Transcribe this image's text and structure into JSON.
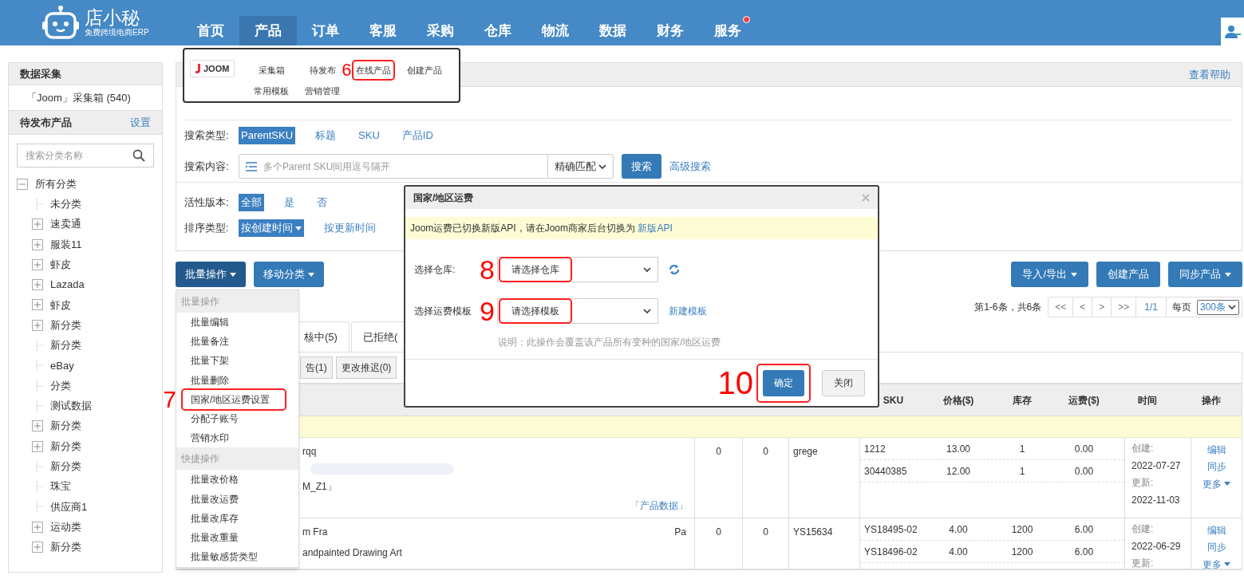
{
  "header": {
    "brand": "店小秘",
    "tagline": "免费跨境电商ERP",
    "nav": [
      {
        "label": "首页",
        "selected": false,
        "badge": false
      },
      {
        "label": "产品",
        "selected": true,
        "badge": false
      },
      {
        "label": "订单",
        "selected": false,
        "badge": false
      },
      {
        "label": "客服",
        "selected": false,
        "badge": false
      },
      {
        "label": "采购",
        "selected": false,
        "badge": false
      },
      {
        "label": "仓库",
        "selected": false,
        "badge": false
      },
      {
        "label": "物流",
        "selected": false,
        "badge": false
      },
      {
        "label": "数据",
        "selected": false,
        "badge": false
      },
      {
        "label": "财务",
        "selected": false,
        "badge": false
      },
      {
        "label": "服务",
        "selected": false,
        "badge": true
      }
    ]
  },
  "sidebar": {
    "collect_title": "数据采集",
    "collect_items": [
      "「Joom」采集箱 (540)"
    ],
    "pending_title": "待发布产品",
    "pending_action": "设置",
    "search_placeholder": "搜索分类名称",
    "tree": [
      {
        "label": "所有分类",
        "kind": "expanded",
        "children": [
          {
            "label": "未分类",
            "kind": "leaf"
          },
          {
            "label": "速卖通",
            "kind": "collapsed"
          },
          {
            "label": "服装11",
            "kind": "collapsed"
          },
          {
            "label": "虾皮",
            "kind": "collapsed"
          },
          {
            "label": "Lazada",
            "kind": "collapsed"
          },
          {
            "label": "虾皮",
            "kind": "collapsed"
          },
          {
            "label": "新分类",
            "kind": "collapsed"
          },
          {
            "label": "新分类",
            "kind": "leaf"
          },
          {
            "label": "eBay",
            "kind": "leaf"
          },
          {
            "label": "分类",
            "kind": "leaf"
          },
          {
            "label": "测试数据",
            "kind": "leaf"
          },
          {
            "label": "新分类",
            "kind": "collapsed"
          },
          {
            "label": "新分类",
            "kind": "collapsed"
          },
          {
            "label": "新分类",
            "kind": "leaf"
          },
          {
            "label": "珠宝",
            "kind": "leaf"
          },
          {
            "label": "供应商1",
            "kind": "leaf"
          },
          {
            "label": "运动类",
            "kind": "collapsed"
          },
          {
            "label": "新分类",
            "kind": "collapsed"
          }
        ]
      }
    ]
  },
  "panel": {
    "help": "查看帮助",
    "search_type": {
      "label": "搜索类型:",
      "options": [
        {
          "label": "ParentSKU",
          "selected": true
        },
        {
          "label": "标题",
          "selected": false
        },
        {
          "label": "SKU",
          "selected": false
        },
        {
          "label": "产品ID",
          "selected": false
        }
      ]
    },
    "search_content": {
      "label": "搜索内容:",
      "placeholder": "多个Parent SKU间用逗号隔开",
      "match": "精确匹配",
      "button": "搜索",
      "advanced": "高级搜索"
    },
    "active_version": {
      "label": "活性版本:",
      "options": [
        {
          "label": "全部",
          "selected": true
        },
        {
          "label": "是",
          "selected": false
        },
        {
          "label": "否",
          "selected": false
        }
      ]
    },
    "sort_type": {
      "label": "排序类型:",
      "options": [
        {
          "label": "按创建时间",
          "selected": true,
          "menu": true
        },
        {
          "label": "按更新时间",
          "selected": false,
          "menu": false
        }
      ]
    }
  },
  "toolbar": {
    "left": [
      {
        "label": "批量操作",
        "active": true,
        "menu": true
      },
      {
        "label": "移动分类",
        "active": false,
        "menu": true
      }
    ],
    "right": [
      {
        "label": "导入/导出",
        "menu": true
      },
      {
        "label": "创建产品",
        "menu": false
      },
      {
        "label": "同步产品",
        "menu": true
      }
    ]
  },
  "pagination": {
    "summary": "第1-6条，共6条",
    "buttons": [
      "<<",
      "<",
      ">",
      ">>"
    ],
    "page": "1/1",
    "per_page_label": "每页",
    "per_page": "300条"
  },
  "tabs": [
    {
      "label": "核中(5)",
      "selected": false
    },
    {
      "label": "已拒绝(",
      "selected": false
    }
  ],
  "filters": [
    "告(1)",
    "更改推迟(0)"
  ],
  "table": {
    "columns": [
      "SKU",
      "价格($)",
      "库存",
      "运费($)",
      "时间",
      "操作"
    ],
    "rows": [
      {
        "product_lines": [
          "rqq",
          "M_Z1」"
        ],
        "product_link": "「产品数据」",
        "column_2": "0",
        "column_3": "0",
        "column_4": "grege",
        "variants": [
          {
            "sku": "1212",
            "price": "13.00",
            "stock": "1",
            "shipping": "0.00"
          },
          {
            "sku": "30440385",
            "price": "12.00",
            "stock": "1",
            "shipping": "0.00"
          }
        ],
        "time": [
          "创建:",
          "2022-07-27",
          "更新:",
          "2022-11-03"
        ],
        "actions": [
          {
            "label": "编辑",
            "menu": false
          },
          {
            "label": "同步",
            "menu": false
          },
          {
            "label": "更多",
            "menu": true
          }
        ]
      },
      {
        "product_lines": [
          "m Fra",
          "andpainted Drawing Art"
        ],
        "product_tail": "Pa",
        "column_2": "0",
        "column_3": "0",
        "column_4": "YS15634",
        "variants": [
          {
            "sku": "YS18495-02",
            "price": "4.00",
            "stock": "1200",
            "shipping": "6.00"
          },
          {
            "sku": "YS18496-02",
            "price": "4.00",
            "stock": "1200",
            "shipping": "6.00"
          }
        ],
        "time": [
          "创建:",
          "2022-06-29",
          "更新:"
        ],
        "actions": [
          {
            "label": "编辑",
            "menu": false
          },
          {
            "label": "同步",
            "menu": false
          },
          {
            "label": "更多",
            "menu": true
          }
        ]
      }
    ]
  },
  "menu_popup": {
    "logo": "JOOM",
    "items": [
      {
        "label": "采集箱",
        "highlighted": false
      },
      {
        "label": "待发布",
        "highlighted": false
      },
      {
        "label": "在线产品",
        "highlighted": true,
        "callout": "6"
      },
      {
        "label": "创建产品",
        "highlighted": false
      },
      {
        "label": "常用模板",
        "highlighted": false
      },
      {
        "label": "营销管理",
        "highlighted": false
      }
    ]
  },
  "bulk_menu": {
    "groups": [
      {
        "title": "批量操作",
        "items": [
          {
            "label": "批量编辑",
            "highlighted": false
          },
          {
            "label": "批量备注",
            "highlighted": false
          },
          {
            "label": "批量下架",
            "highlighted": false
          },
          {
            "label": "批量删除",
            "highlighted": false
          },
          {
            "label": "国家/地区运费设置",
            "highlighted": true,
            "callout": "7"
          },
          {
            "label": "分配子账号",
            "highlighted": false
          },
          {
            "label": "营销水印",
            "highlighted": false
          }
        ]
      },
      {
        "title": "快捷操作",
        "items": [
          {
            "label": "批量改价格",
            "highlighted": false
          },
          {
            "label": "批量改运费",
            "highlighted": false
          },
          {
            "label": "批量改库存",
            "highlighted": false
          },
          {
            "label": "批量改重量",
            "highlighted": false
          },
          {
            "label": "批量敏感货类型",
            "highlighted": false
          }
        ]
      }
    ]
  },
  "dialog": {
    "title": "国家/地区运费",
    "notice": "Joom运费已切换新版API，请在Joom商家后台切换为",
    "notice_link": "新版API",
    "fields": [
      {
        "label": "选择仓库:",
        "value": "请选择仓库",
        "highlighted": true,
        "callout": "8",
        "kind": "refresh"
      },
      {
        "label": "选择运费模板",
        "value": "请选择模板",
        "highlighted": true,
        "callout": "9",
        "kind": "link",
        "link": "新建模板"
      }
    ],
    "note": "说明：此操作会覆盖该产品所有变种的国家/地区运费",
    "buttons": [
      {
        "label": "确定",
        "primary": true,
        "highlighted": true,
        "callout": "10"
      },
      {
        "label": "关闭",
        "primary": false,
        "highlighted": false
      }
    ]
  }
}
